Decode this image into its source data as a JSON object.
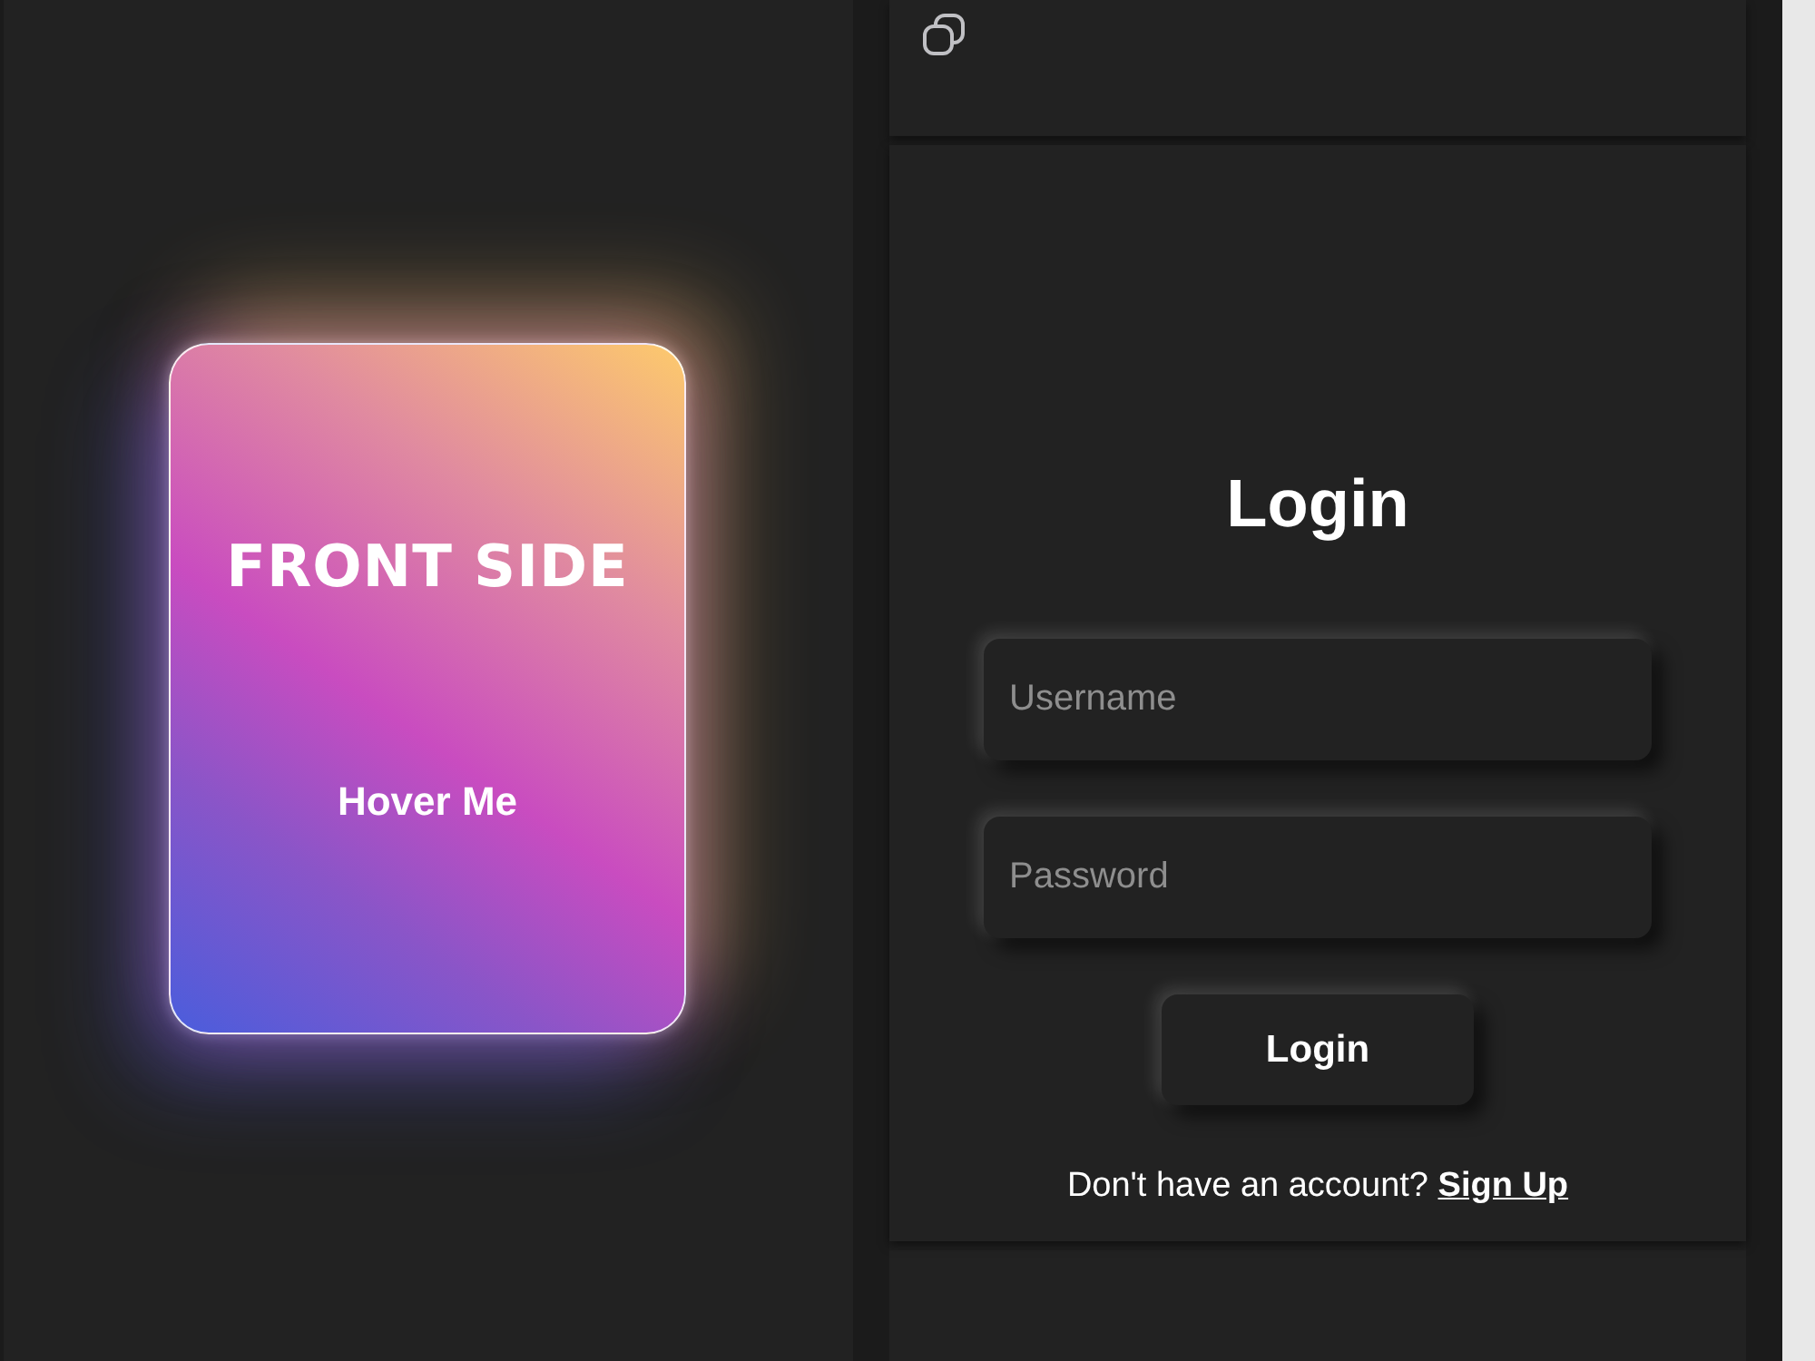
{
  "card": {
    "title": "FRONT SIDE",
    "hint": "Hover Me"
  },
  "login": {
    "title": "Login",
    "fields": [
      {
        "placeholder": "Username"
      },
      {
        "placeholder": "Password"
      }
    ],
    "button": "Login",
    "signup_prompt": "Don't have an account?",
    "signup_link": "Sign Up"
  }
}
